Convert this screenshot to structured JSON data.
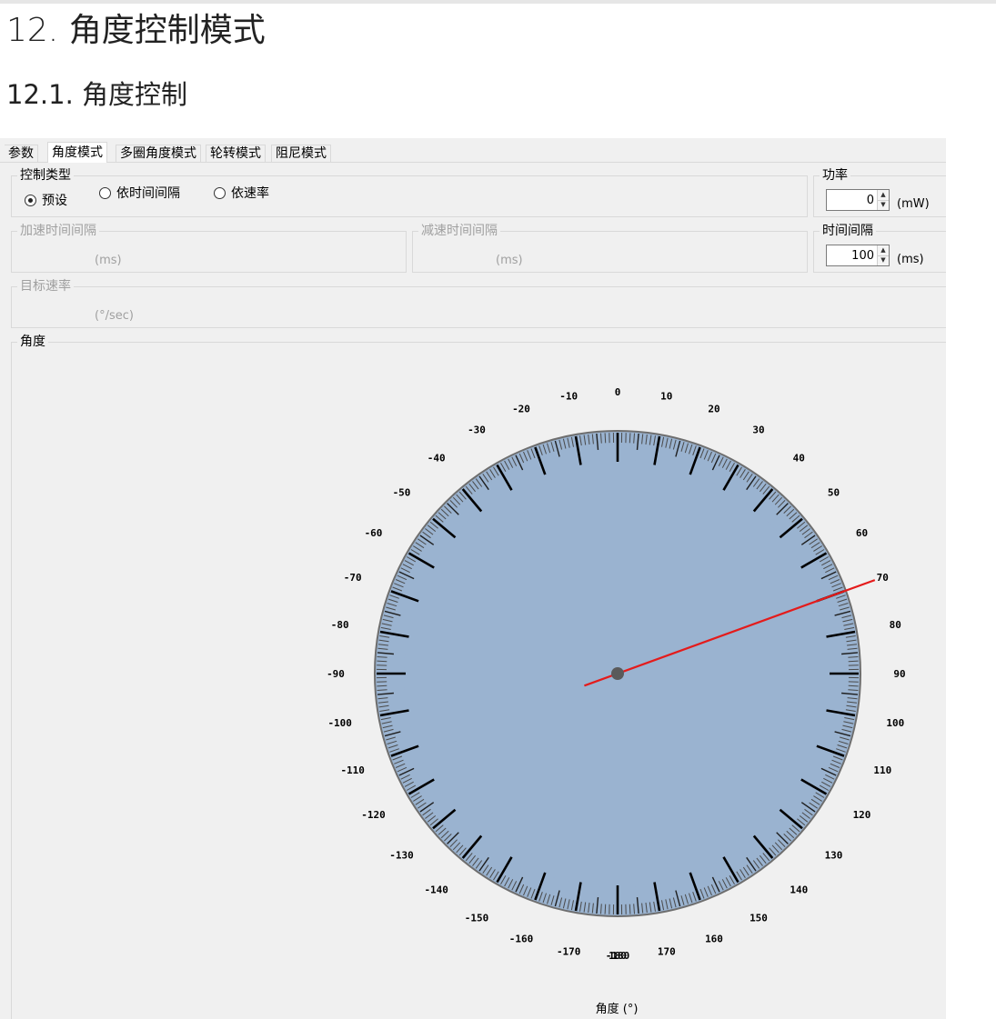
{
  "doc": {
    "title": "12. 角度控制模式",
    "subtitle": "12.1. 角度控制"
  },
  "tabs": [
    {
      "label": "参数",
      "active": false
    },
    {
      "label": "角度模式",
      "active": true
    },
    {
      "label": "多圈角度模式",
      "active": false
    },
    {
      "label": "轮转模式",
      "active": false
    },
    {
      "label": "阻尼模式",
      "active": false
    }
  ],
  "control_type": {
    "label": "控制类型",
    "options": [
      {
        "label": "预设",
        "selected": true
      },
      {
        "label": "依时间间隔",
        "selected": false
      },
      {
        "label": "依速率",
        "selected": false
      }
    ]
  },
  "power": {
    "label": "功率",
    "value": "0",
    "unit": "(mW)"
  },
  "accel": {
    "label": "加速时间间隔",
    "unit": "(ms)"
  },
  "decel": {
    "label": "减速时间间隔",
    "unit": "(ms)"
  },
  "interval": {
    "label": "时间间隔",
    "value": "100",
    "unit": "(ms)"
  },
  "target_rate": {
    "label": "目标速率",
    "unit": "(°/sec)"
  },
  "angle_group": {
    "label": "角度"
  },
  "dial": {
    "needle_angle": 70,
    "axis_label": "角度 (°)",
    "face_color": "#9ab3d0",
    "needle_color": "#e41b1b",
    "labels": [
      "0",
      "10",
      "20",
      "30",
      "40",
      "50",
      "60",
      "70",
      "80",
      "90",
      "100",
      "110",
      "120",
      "130",
      "140",
      "150",
      "160",
      "170",
      "180",
      "-180",
      "-170",
      "-160",
      "-150",
      "-140",
      "-130",
      "-120",
      "-110",
      "-100",
      "-90",
      "-80",
      "-70",
      "-60",
      "-50",
      "-40",
      "-30",
      "-20",
      "-10"
    ]
  }
}
